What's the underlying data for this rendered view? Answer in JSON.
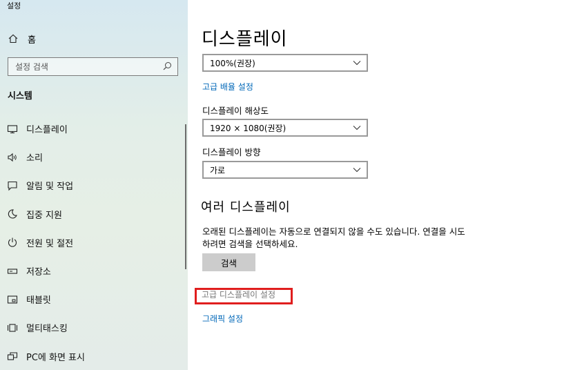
{
  "window": {
    "title": "설정"
  },
  "sidebar": {
    "home_label": "홈",
    "search_placeholder": "설정 검색",
    "section_title": "시스템",
    "items": [
      {
        "label": "디스플레이",
        "icon": "monitor-icon"
      },
      {
        "label": "소리",
        "icon": "speaker-icon"
      },
      {
        "label": "알림 및 작업",
        "icon": "notification-icon"
      },
      {
        "label": "집중 지원",
        "icon": "moon-icon"
      },
      {
        "label": "전원 및 절전",
        "icon": "power-icon"
      },
      {
        "label": "저장소",
        "icon": "storage-icon"
      },
      {
        "label": "태블릿",
        "icon": "tablet-icon"
      },
      {
        "label": "멀티태스킹",
        "icon": "multitasking-icon"
      },
      {
        "label": "PC에 화면 표시",
        "icon": "project-icon"
      }
    ]
  },
  "main": {
    "title": "디스플레이",
    "scale_select": "100%(권장)",
    "advanced_scaling_link": "고급 배율 설정",
    "resolution_label": "디스플레이 해상도",
    "resolution_select": "1920 × 1080(권장)",
    "orientation_label": "디스플레이 방향",
    "orientation_select": "가로",
    "multi_title": "여러 디스플레이",
    "multi_desc": "오래된 디스플레이는 자동으로 연결되지 않을 수도 있습니다. 연결을 시도하려면 검색을 선택하세요.",
    "detect_button": "검색",
    "advanced_display_link": "고급 디스플레이 설정",
    "graphics_link": "그래픽 설정"
  },
  "colors": {
    "accent": "#0067b8",
    "highlight_box": "#e01e1e"
  }
}
